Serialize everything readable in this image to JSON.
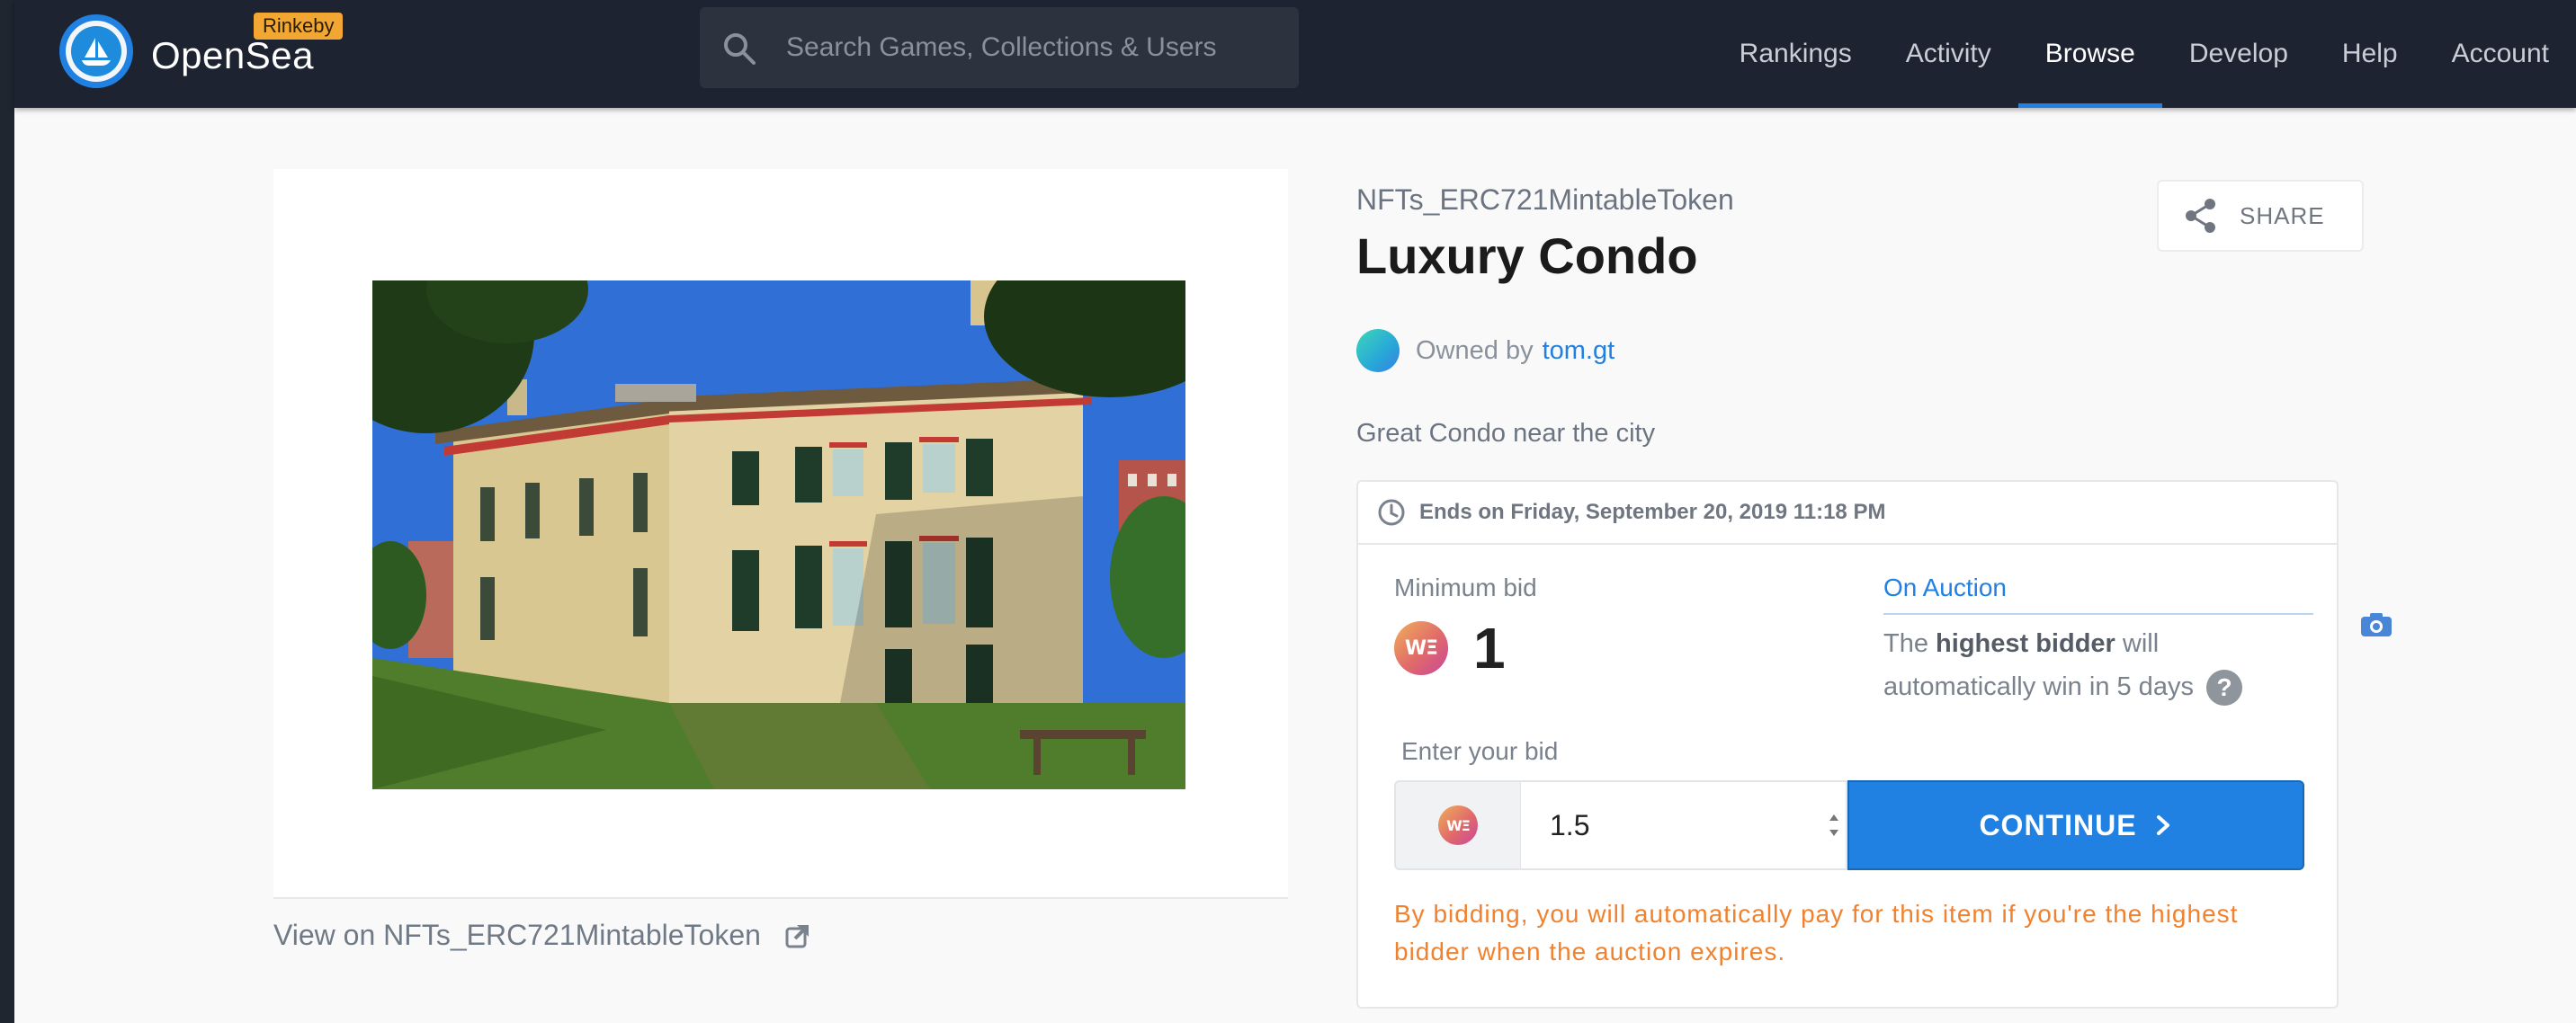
{
  "nav": {
    "brand": "OpenSea",
    "network_badge": "Rinkeby",
    "search_placeholder": "Search Games, Collections & Users",
    "links": [
      {
        "label": "Rankings"
      },
      {
        "label": "Activity"
      },
      {
        "label": "Browse",
        "active": true
      },
      {
        "label": "Develop"
      },
      {
        "label": "Help"
      },
      {
        "label": "Account"
      }
    ]
  },
  "asset": {
    "image_icon": "house-photo",
    "view_on_label": "View on NFTs_ERC721MintableToken",
    "collection": "NFTs_ERC721MintableToken",
    "title": "Luxury Condo",
    "owned_by_label": "Owned by",
    "owner": "tom.gt",
    "description": "Great Condo near the city",
    "share_label": "SHARE"
  },
  "auction": {
    "ends_text": "Ends on Friday, September 20, 2019 11:18 PM",
    "min_bid_label": "Minimum bid",
    "min_bid_value": "1",
    "currency_icon": "weth-icon",
    "status": "On Auction",
    "info_prefix": "The",
    "info_bold": "highest bidder",
    "info_suffix": "will automatically win in 5 days",
    "help_glyph": "?",
    "enter_bid_label": "Enter your bid",
    "bid_value": "1.5",
    "continue_label": "CONTINUE",
    "warning": "By bidding, you will automatically pay for this item if you're the highest bidder when the auction expires."
  },
  "colors": {
    "nav_bg": "#1d2330",
    "accent": "#2081e2",
    "badge": "#f3a733",
    "warning": "#f0822f"
  }
}
